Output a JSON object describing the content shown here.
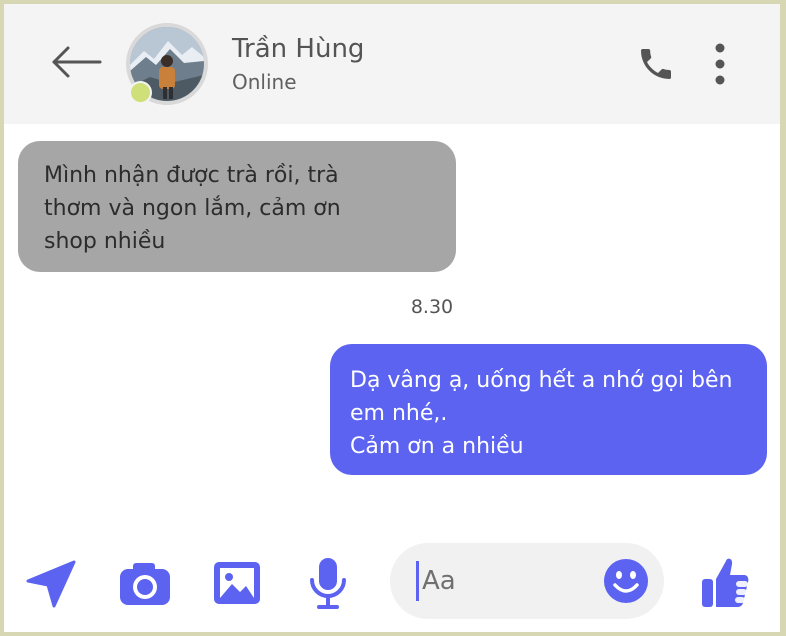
{
  "header": {
    "back_icon": "arrow-left-icon",
    "contact_name": "Trần Hùng",
    "contact_status": "Online",
    "call_icon": "phone-icon",
    "more_icon": "more-vertical-icon"
  },
  "messages": [
    {
      "direction": "incoming",
      "lines": [
        "Mình nhận được trà rồi, trà",
        "thơm và ngon lắm, cảm ơn",
        "shop nhiều"
      ]
    },
    {
      "direction": "outgoing",
      "lines": [
        "Dạ vâng ạ, uống hết a nhớ gọi bên",
        "em nhé,.",
        "Cảm ơn a nhiều"
      ]
    }
  ],
  "timestamp": "8.30",
  "composer": {
    "placeholder": "Aa",
    "value": "",
    "tools": [
      "send-location-icon",
      "camera-icon",
      "image-icon",
      "microphone-icon"
    ],
    "emoji_icon": "smiley-icon",
    "like_icon": "thumbs-up-icon"
  },
  "colors": {
    "accent": "#5b63f0",
    "header_bg": "#f4f4f4",
    "incoming_bubble": "#a6a6a6",
    "outgoing_bubble": "#5b63f0",
    "online_dot": "#cfe07a",
    "frame_border": "#d8d7b3"
  }
}
